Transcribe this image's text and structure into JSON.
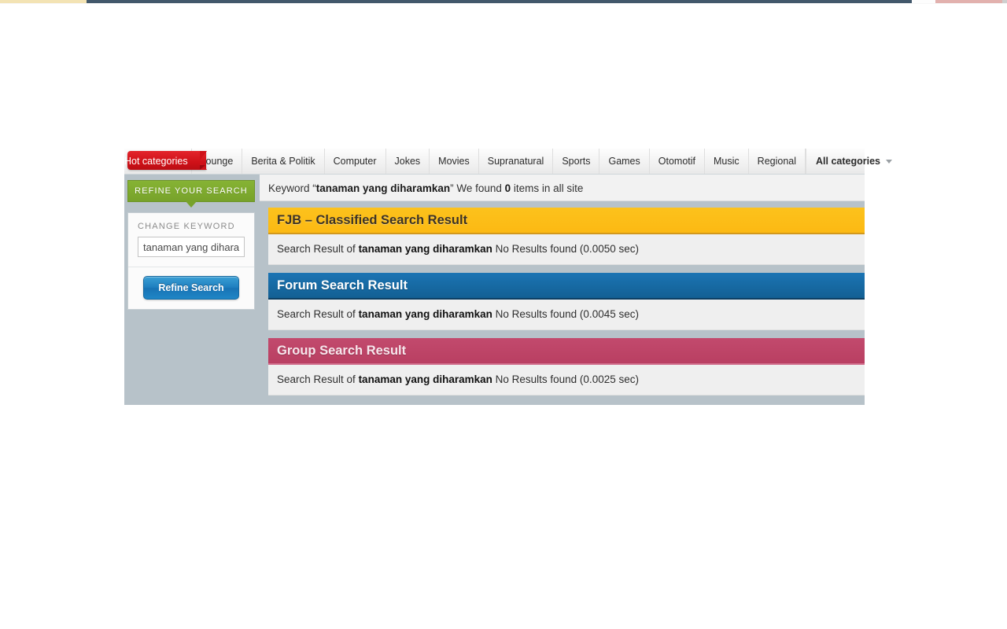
{
  "nav": {
    "hot_tab": "Hot categories",
    "items": [
      "Lounge",
      "Berita & Politik",
      "Computer",
      "Jokes",
      "Movies",
      "Supranatural",
      "Sports",
      "Games",
      "Otomotif",
      "Music",
      "Regional"
    ],
    "all_categories": "All categories",
    "caret_icon": "chevron-down-icon"
  },
  "sidebar": {
    "refine_tab_label": "REFINE YOUR SEARCH",
    "change_keyword_label": "CHANGE KEYWORD",
    "keyword_value": "tanaman yang diharamkan",
    "keyword_placeholder": "tanaman yang diharamkan",
    "refine_button_label": "Refine Search"
  },
  "keyword_bar": {
    "prefix": "Keyword “",
    "keyword": "tanaman yang diharamkan",
    "middle": "” We found ",
    "count": "0",
    "suffix": " items in all site"
  },
  "results": [
    {
      "title": "FJB – Classified Search Result",
      "color_class": "yellow",
      "accent": "#fcb913",
      "prefix": "Search Result of ",
      "keyword": "tanaman yang diharamkan",
      "status": " No Results found (0.0050 sec)"
    },
    {
      "title": "Forum Search Result",
      "color_class": "blue",
      "accent": "#1b74b4",
      "prefix": "Search Result of ",
      "keyword": "tanaman yang diharamkan",
      "status": " No Results found (0.0045 sec)"
    },
    {
      "title": "Group Search Result",
      "color_class": "pink",
      "accent": "#c24a6d",
      "prefix": "Search Result of ",
      "keyword": "tanaman yang diharamkan",
      "status": " No Results found (0.0025 sec)"
    }
  ]
}
